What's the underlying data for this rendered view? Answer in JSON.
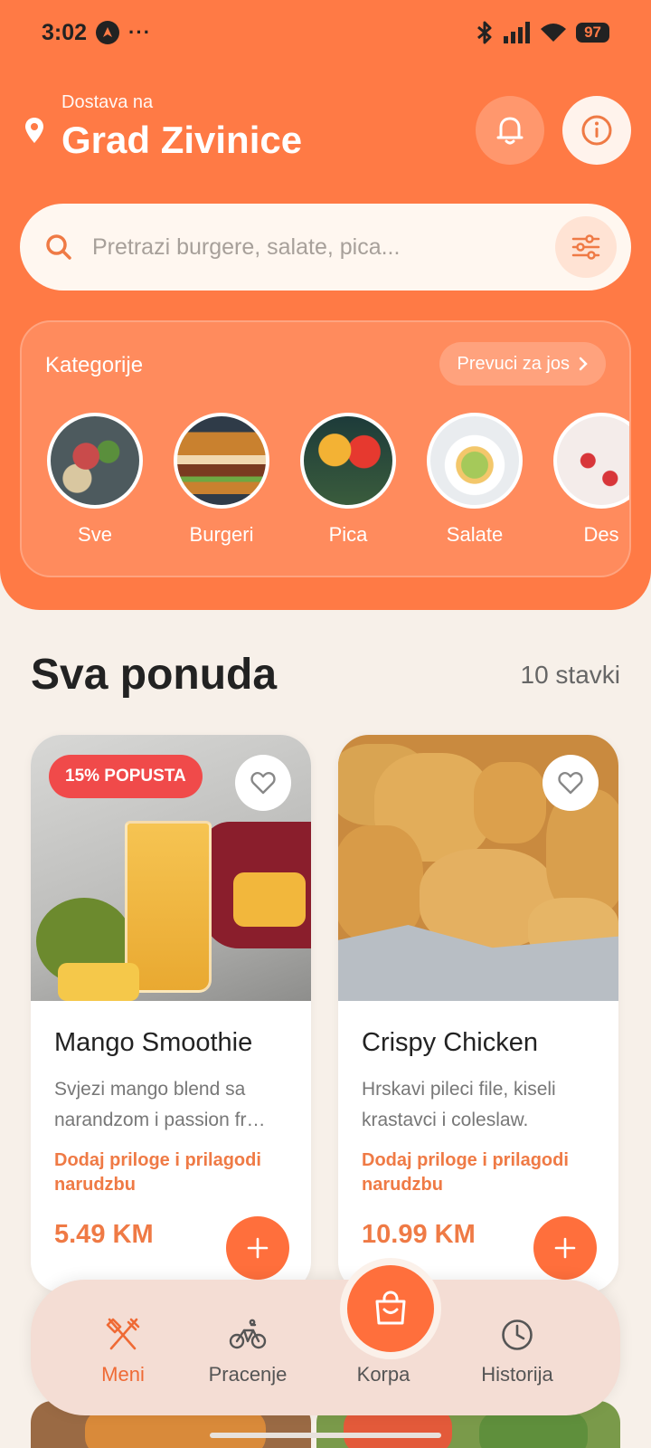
{
  "status_bar": {
    "time": "3:02",
    "dots": "···",
    "battery": "97"
  },
  "header": {
    "location_label": "Dostava na",
    "city": "Grad Zivinice"
  },
  "search": {
    "placeholder": "Pretrazi burgere, salate, pica..."
  },
  "categories": {
    "title": "Kategorije",
    "more": "Prevuci za jos",
    "items": [
      {
        "label": "Sve"
      },
      {
        "label": "Burgeri"
      },
      {
        "label": "Pica"
      },
      {
        "label": "Salate"
      },
      {
        "label": "Des"
      }
    ]
  },
  "section": {
    "title": "Sva ponuda",
    "count": "10 stavki"
  },
  "products": [
    {
      "badge": "15% POPUSTA",
      "title": "Mango Smoothie",
      "description": "Svjezi mango blend sa narandzom i passion fr…",
      "customize": "Dodaj priloge i prilagodi narudzbu",
      "price": "5.49 KM"
    },
    {
      "title": "Crispy Chicken",
      "description": "Hrskavi pileci file, kiseli krastavci i coleslaw.",
      "customize": "Dodaj priloge i prilagodi narudzbu",
      "price": "10.99 KM"
    }
  ],
  "bottom_nav": {
    "items": [
      {
        "label": "Meni",
        "icon": "utensils-icon",
        "active": true
      },
      {
        "label": "Pracenje",
        "icon": "bicycle-icon"
      },
      {
        "label": "Korpa",
        "icon": "shopping-bag-icon"
      },
      {
        "label": "Historija",
        "icon": "clock-icon"
      }
    ]
  },
  "colors": {
    "primary": "#ff7a45",
    "accent": "#ff6f3c",
    "badge": "#f04a4a",
    "background": "#f7f0e9"
  }
}
